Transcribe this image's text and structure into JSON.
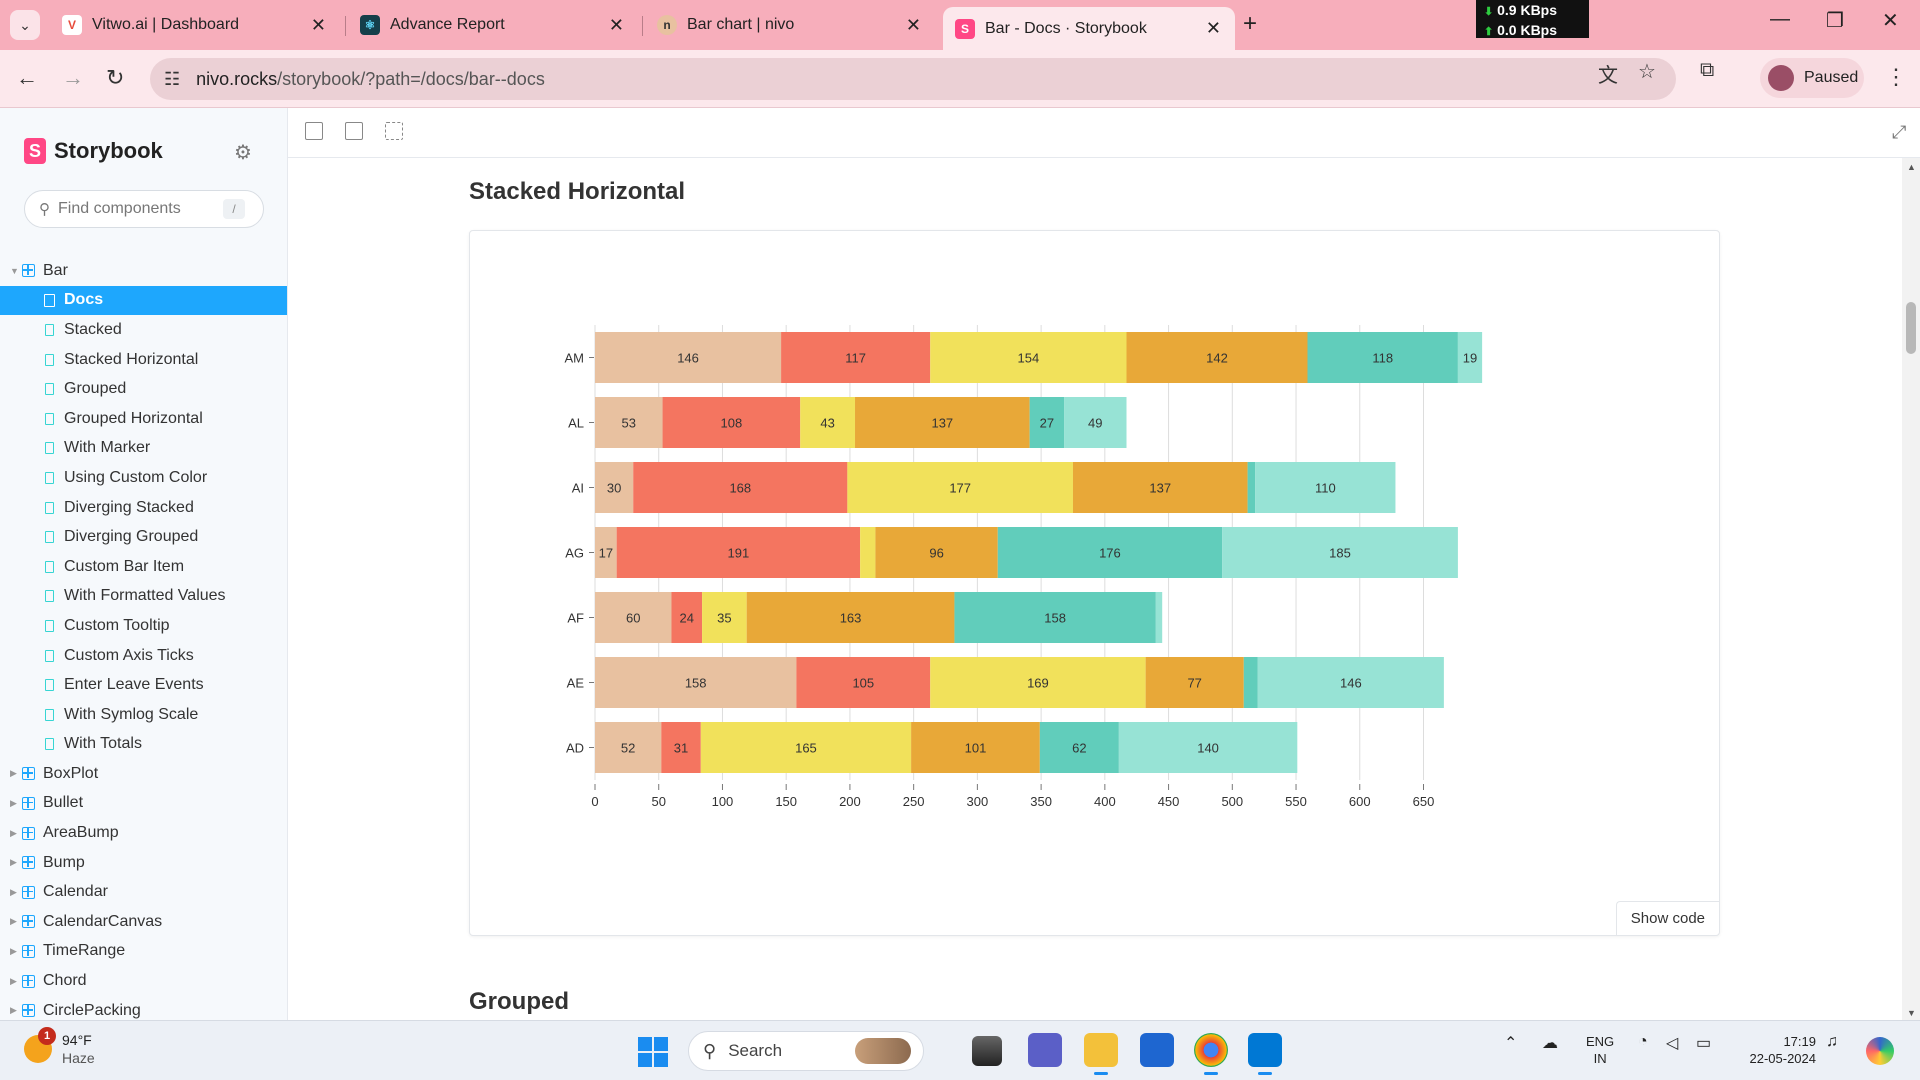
{
  "browser": {
    "tabs": [
      {
        "title": "Vitwo.ai | Dashboard",
        "icon": "vitwo-icon",
        "active": false
      },
      {
        "title": "Advance Report",
        "icon": "react-icon",
        "active": false
      },
      {
        "title": "Bar chart | nivo",
        "icon": "nivo-icon",
        "active": false
      },
      {
        "title": "Bar - Docs · Storybook",
        "icon": "storybook-icon",
        "active": true
      }
    ],
    "net_down": "0.9 KBps",
    "net_up": "0.0 KBps",
    "url_host": "nivo.rocks",
    "url_path": "/storybook/?path=/docs/bar--docs",
    "profile_status": "Paused"
  },
  "sidebar": {
    "brand": "Storybook",
    "search_placeholder": "Find components",
    "search_shortcut": "/",
    "bar_group": "Bar",
    "stories": [
      {
        "label": "Docs",
        "selected": true
      },
      {
        "label": "Stacked"
      },
      {
        "label": "Stacked Horizontal"
      },
      {
        "label": "Grouped"
      },
      {
        "label": "Grouped Horizontal"
      },
      {
        "label": "With Marker"
      },
      {
        "label": "Using Custom Color"
      },
      {
        "label": "Diverging Stacked"
      },
      {
        "label": "Diverging Grouped"
      },
      {
        "label": "Custom Bar Item"
      },
      {
        "label": "With Formatted Values"
      },
      {
        "label": "Custom Tooltip"
      },
      {
        "label": "Custom Axis Ticks"
      },
      {
        "label": "Enter Leave Events"
      },
      {
        "label": "With Symlog Scale"
      },
      {
        "label": "With Totals"
      }
    ],
    "components": [
      "BoxPlot",
      "Bullet",
      "AreaBump",
      "Bump",
      "Calendar",
      "CalendarCanvas",
      "TimeRange",
      "Chord",
      "CirclePacking"
    ]
  },
  "docs": {
    "section_title": "Stacked Horizontal",
    "next_section_title": "Grouped",
    "show_code_label": "Show code"
  },
  "chart_data": {
    "type": "bar",
    "orientation": "horizontal",
    "stacked": true,
    "categories": [
      "AD",
      "AE",
      "AF",
      "AG",
      "AI",
      "AL",
      "AM"
    ],
    "series": [
      {
        "name": "",
        "color": "#e8c1a0",
        "values": [
          52,
          158,
          60,
          17,
          30,
          53,
          146
        ]
      },
      {
        "name": "",
        "color": "#f47560",
        "values": [
          31,
          105,
          24,
          191,
          168,
          108,
          117
        ]
      },
      {
        "name": "",
        "color": "#f1e15b",
        "values": [
          165,
          169,
          35,
          12,
          177,
          43,
          154
        ]
      },
      {
        "name": "",
        "color": "#e8a838",
        "values": [
          101,
          77,
          163,
          96,
          137,
          137,
          142
        ]
      },
      {
        "name": "",
        "color": "#61cdbb",
        "values": [
          62,
          11,
          158,
          176,
          6,
          27,
          118
        ]
      },
      {
        "name": "",
        "color": "#97e3d5",
        "values": [
          140,
          146,
          5,
          185,
          110,
          49,
          19
        ]
      }
    ],
    "label_skip_below": 15,
    "xlim": [
      0,
      700
    ],
    "xticks": [
      0,
      50,
      100,
      150,
      200,
      250,
      300,
      350,
      400,
      450,
      500,
      550,
      600,
      650
    ],
    "grid_x": true,
    "title": "",
    "xlabel": "",
    "ylabel": ""
  },
  "taskbar": {
    "temperature": "94°F",
    "weather": "Haze",
    "weather_alerts": "1",
    "search_label": "Search",
    "lang_line1": "ENG",
    "lang_line2": "IN",
    "time": "17:19",
    "date": "22-05-2024"
  }
}
